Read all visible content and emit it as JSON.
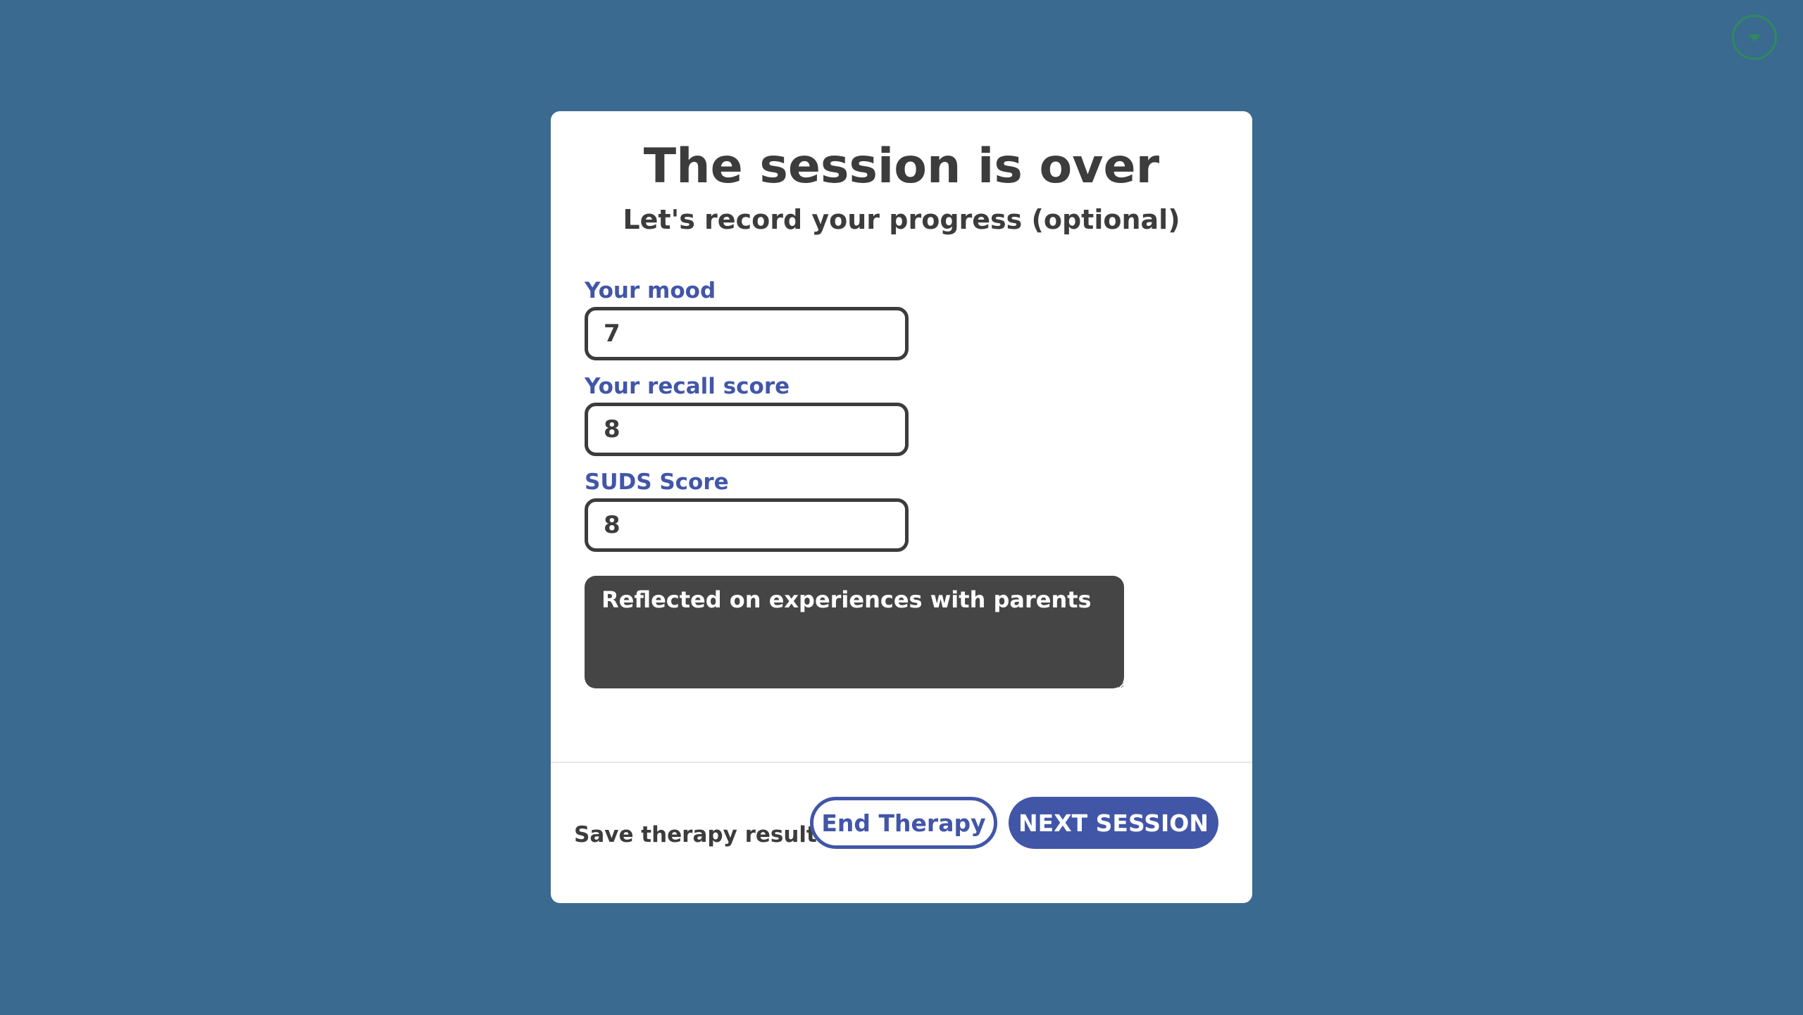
{
  "menu": {
    "icon": "chevron-down-icon",
    "accent_color": "#2e8a5e"
  },
  "modal": {
    "title": "The session is over",
    "subtitle": "Let's record your progress (optional)",
    "fields": [
      {
        "label": "Your mood",
        "value": "7"
      },
      {
        "label": "Your recall score",
        "value": "8"
      },
      {
        "label": "SUDS Score",
        "value": "8"
      }
    ],
    "notes": "Reflected on experiences with parents",
    "save_option": {
      "label": "Save therapy results on exit",
      "checked": true
    },
    "buttons": {
      "end": "End Therapy",
      "next": "NEXT SESSION"
    }
  },
  "colors": {
    "background": "#3b6a90",
    "accent": "#4256a8",
    "text": "#3c3c3c",
    "notes_bg": "#454545",
    "checkbox": "#3b82f6"
  }
}
